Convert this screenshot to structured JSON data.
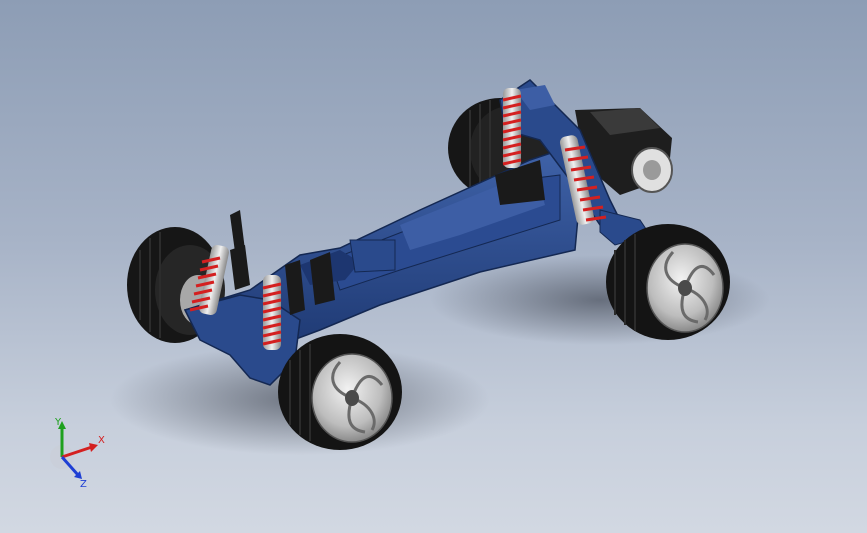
{
  "viewport": {
    "background_top": "#8d9db5",
    "background_bottom": "#d2d8e2"
  },
  "model": {
    "chassis_color": "#2a4a8c",
    "tire_color": "#1b1b1b",
    "rim_color": "#d9d9d9",
    "spring_color": "#d42020",
    "motor_color": "#202020"
  },
  "triad": {
    "x_label": "X",
    "y_label": "Y",
    "z_label": "Z",
    "x_color": "#d42020",
    "y_color": "#1ea01e",
    "z_color": "#1e3fd4"
  }
}
